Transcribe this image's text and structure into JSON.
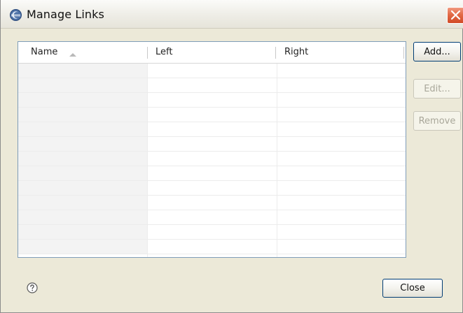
{
  "dialog": {
    "title": "Manage Links",
    "icons": {
      "app": "eclipse-icon",
      "close": "close-icon",
      "help": "help-icon",
      "sort": "sort-ascending-icon"
    }
  },
  "table": {
    "columns": [
      "Name",
      "Left",
      "Right"
    ],
    "sorted_column": "Name",
    "sort_direction": "ascending",
    "rows": []
  },
  "buttons": {
    "add": "Add...",
    "edit": "Edit...",
    "remove": "Remove",
    "close": "Close"
  },
  "colors": {
    "dialog_background": "#ece9d8",
    "close_button": "#e26a46",
    "table_border": "#7f9db9"
  }
}
